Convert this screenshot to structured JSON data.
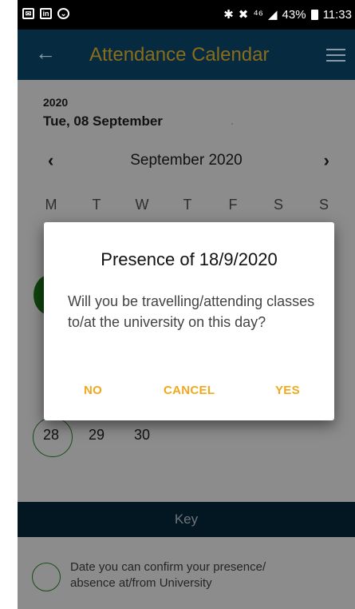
{
  "status_bar": {
    "left_icons": [
      "mail-icon",
      "linkedin-icon",
      "download-icon"
    ],
    "signal_text": "⁴⁶",
    "battery": "43%",
    "time": "11:33"
  },
  "app_bar": {
    "title": "Attendance Calendar"
  },
  "calendar": {
    "year": "2020",
    "selected_date": "Tue, 08 September",
    "month_label": "September 2020",
    "weekdays": [
      "M",
      "T",
      "W",
      "T",
      "F",
      "S",
      "S"
    ],
    "last_week_days": [
      "28",
      "29",
      "30"
    ]
  },
  "key": {
    "title": "Key",
    "item_text": "Date you can confirm your presence/ absence at/from University"
  },
  "dialog": {
    "title": "Presence of 18/9/2020",
    "message": "Will you be travelling/attending classes to/at the university on this day?",
    "no_label": "NO",
    "cancel_label": "CANCEL",
    "yes_label": "YES"
  },
  "colors": {
    "app_bar": "#062b40",
    "accent": "#f2a81c",
    "green": "#2e8b2e"
  }
}
